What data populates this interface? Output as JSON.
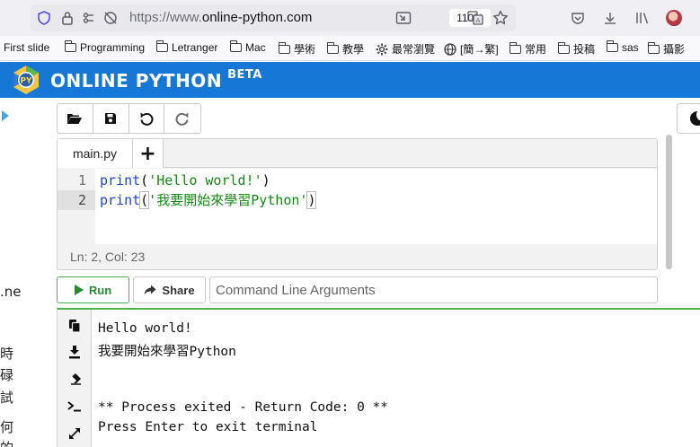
{
  "browser": {
    "url_prefix": "https://www.",
    "url_host": "online-python.com",
    "zoom": "110%"
  },
  "bookmarks": [
    {
      "label": "First slide",
      "icon": "none"
    },
    {
      "label": "Programming",
      "icon": "folder-icon"
    },
    {
      "label": "Letranger",
      "icon": "folder-icon"
    },
    {
      "label": "Mac",
      "icon": "folder-icon"
    },
    {
      "label": "學術",
      "icon": "folder-icon"
    },
    {
      "label": "教學",
      "icon": "folder-icon"
    },
    {
      "label": "最常瀏覽",
      "icon": "gear-icon"
    },
    {
      "label": "[簡→繁]",
      "icon": "globe-icon"
    },
    {
      "label": "常用",
      "icon": "folder-icon"
    },
    {
      "label": "投稿",
      "icon": "folder-icon"
    },
    {
      "label": "sas",
      "icon": "folder-icon"
    },
    {
      "label": "攝影",
      "icon": "folder-icon"
    }
  ],
  "app": {
    "brand": "ONLINE PYTHON",
    "badge": "BETA",
    "logo_text": "PY",
    "accent_color": "#1777d6"
  },
  "left_strip": [
    ".ne",
    "時",
    "碌",
    "試",
    "何",
    "的"
  ],
  "toolbar": {
    "open": "open-folder-icon",
    "save": "save-icon",
    "undo": "undo-icon",
    "redo": "redo-icon"
  },
  "editor": {
    "tab_name": "main.py",
    "add_tab": "+",
    "lines": [
      {
        "num": "1",
        "fn": "print",
        "open": "(",
        "str": "'Hello world!'",
        "close": ")"
      },
      {
        "num": "2",
        "fn": "print",
        "open": "(",
        "str": "'我要開始來學習Python'",
        "close": ")"
      }
    ],
    "status": "Ln: 2,  Col: 23"
  },
  "actions": {
    "run_label": "Run",
    "share_label": "Share",
    "args_placeholder": "Command Line Arguments",
    "args_value": ""
  },
  "terminal": {
    "lines": [
      "Hello world!",
      "我要開始來學習Python",
      "",
      "",
      "** Process exited - Return Code: 0 **",
      "Press Enter to exit terminal"
    ]
  }
}
